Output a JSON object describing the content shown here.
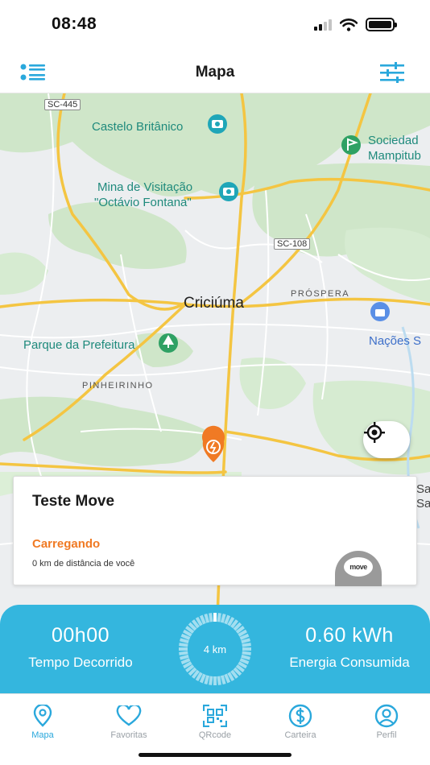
{
  "status_bar": {
    "time": "08:48"
  },
  "header": {
    "title": "Mapa",
    "left_icon": "list-icon",
    "right_icon": "filter-sliders-icon"
  },
  "map": {
    "places": {
      "castelo": "Castelo Britânico",
      "sociedade_1": "Sociedad",
      "sociedade_2": "Mampitub",
      "mina_1": "Mina de Visitação",
      "mina_2": "\"Octávio Fontana\"",
      "city": "Criciúma",
      "parque": "Parque da Prefeitura",
      "nacoes": "Nações S",
      "sa1": "Sa",
      "sa2": "Sa"
    },
    "districts": {
      "prospera": "PRÓSPERA",
      "pinheirinho": "PINHEIRINHO"
    },
    "roads": {
      "sc445": "SC-445",
      "sc108": "SC-108"
    }
  },
  "station": {
    "name": "Teste Move",
    "status": "Carregando",
    "distance": "0 km de distância de você",
    "brand": "move"
  },
  "charging": {
    "time_value": "00h00",
    "time_label": "Tempo Decorrido",
    "energy_value": "0.60 kWh",
    "energy_label": "Energia Consumida",
    "gauge_label": "4 km",
    "gauge_progress": 0.03
  },
  "tabs": [
    {
      "label": "Mapa",
      "icon": "map-pin-icon",
      "active": true
    },
    {
      "label": "Favoritas",
      "icon": "heart-icon",
      "active": false
    },
    {
      "label": "QRcode",
      "icon": "qrcode-icon",
      "active": false
    },
    {
      "label": "Carteira",
      "icon": "dollar-icon",
      "active": false
    },
    {
      "label": "Perfil",
      "icon": "profile-icon",
      "active": false
    }
  ],
  "colors": {
    "accent": "#2aa8dc",
    "panel": "#34b6de",
    "charging_status": "#f07a24",
    "map_green": "#cfe6c9",
    "road_yellow": "#f4c542",
    "poi_teal": "#1f8a7c"
  }
}
